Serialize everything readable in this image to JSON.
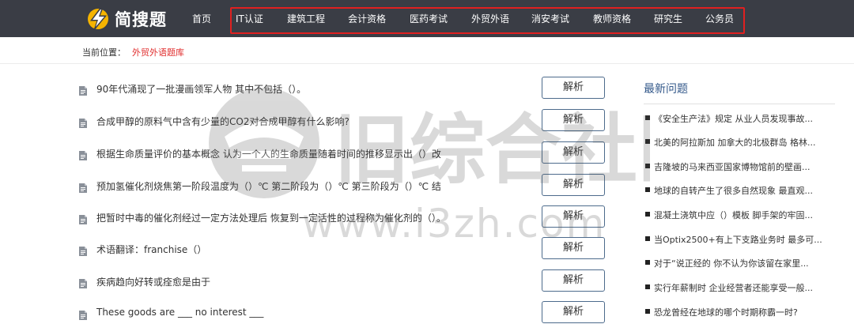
{
  "brand": {
    "name": "简搜题"
  },
  "nav": {
    "items": [
      "首页",
      "IT认证",
      "建筑工程",
      "会计资格",
      "医药考试",
      "外贸外语",
      "消安考试",
      "教师资格",
      "研究生",
      "公务员"
    ]
  },
  "breadcrumb": {
    "label": "当前位置：",
    "current": "外贸外语题库"
  },
  "questions": [
    {
      "text": "90年代涌现了一批漫画领军人物 其中不包括（）。",
      "button": "解析"
    },
    {
      "text": "合成甲醇的原料气中含有少量的CO2对合成甲醇有什么影响?",
      "button": "解析"
    },
    {
      "text": "根据生命质量评价的基本概念 认为一个人的生命质量随着时间的推移显示出（）改",
      "button": "解析"
    },
    {
      "text": "预加氢催化剂烧焦第一阶段温度为（）℃ 第二阶段为（）℃ 第三阶段为（）℃ 结",
      "button": "解析"
    },
    {
      "text": "把暂时中毒的催化剂经过一定方法处理后 恢复到一定活性的过程称为催化剂的（）。",
      "button": "解析"
    },
    {
      "text": "术语翻译：franchise（）",
      "button": "解析"
    },
    {
      "text": "疾病趋向好转或痊愈是由于",
      "button": "解析"
    },
    {
      "text": "These goods are ___ no interest ___",
      "button": "解析"
    }
  ],
  "sidebar": {
    "title": "最新问题",
    "items": [
      "《安全生产法》规定 从业人员发现事故...",
      "北美的阿拉斯加 加拿大的北极群岛 格林...",
      "吉隆坡的马来西亚国家博物馆前的壁画...",
      "地球的自转产生了很多自然现象 最直观...",
      "混凝土浇筑中应（）模板 脚手架的牢固...",
      "当Optix2500+有上下支路业务时 最多可...",
      "对于“说正经的 你不认为你该留在家里...",
      "实行年薪制时 企业经营者还能享受一般...",
      "恐龙曾经在地球的哪个时期称霸一时?"
    ]
  },
  "watermark": {
    "text": "旧综合社区",
    "url": "www.i3zh.com"
  },
  "colors": {
    "topbar": "#3a3d45",
    "highlight": "#e02020",
    "accent": "#e02b2b",
    "sidebar_title": "#33588a",
    "button_border": "#4d6b8c"
  }
}
